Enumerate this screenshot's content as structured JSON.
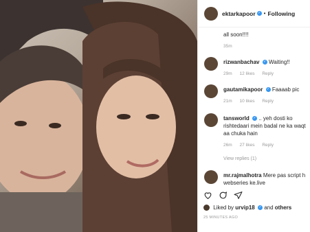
{
  "header": {
    "username": "ektarkapoor",
    "follow_label": "Following"
  },
  "comments": [
    {
      "text": "all soon!!!!",
      "time": "35m"
    },
    {
      "username": "rizwanbachav",
      "text": "Waiting!!",
      "time": "29m",
      "likes": "12 likes",
      "reply": "Reply"
    },
    {
      "username": "gautamikapoor",
      "text": "Faaaab pic",
      "time": "21m",
      "likes": "10 likes",
      "reply": "Reply"
    },
    {
      "username": "tansworld",
      "text": ".. yeh dosti ko rishtedaari mein badal ne ka waqt aa chuka hain",
      "time": "26m",
      "likes": "27 likes",
      "reply": "Reply",
      "view_replies": "View replies (1)"
    },
    {
      "username": "mr.rajmalhotra",
      "text": "Mere pas script h webseries ke.live"
    }
  ],
  "footer": {
    "liked_by": "Liked by",
    "liked_user": "urvip18",
    "and_others": "and others",
    "time_ago": "25 MINUTES AGO"
  },
  "colors": {
    "verified": "#3897f0",
    "meta": "#999999"
  }
}
